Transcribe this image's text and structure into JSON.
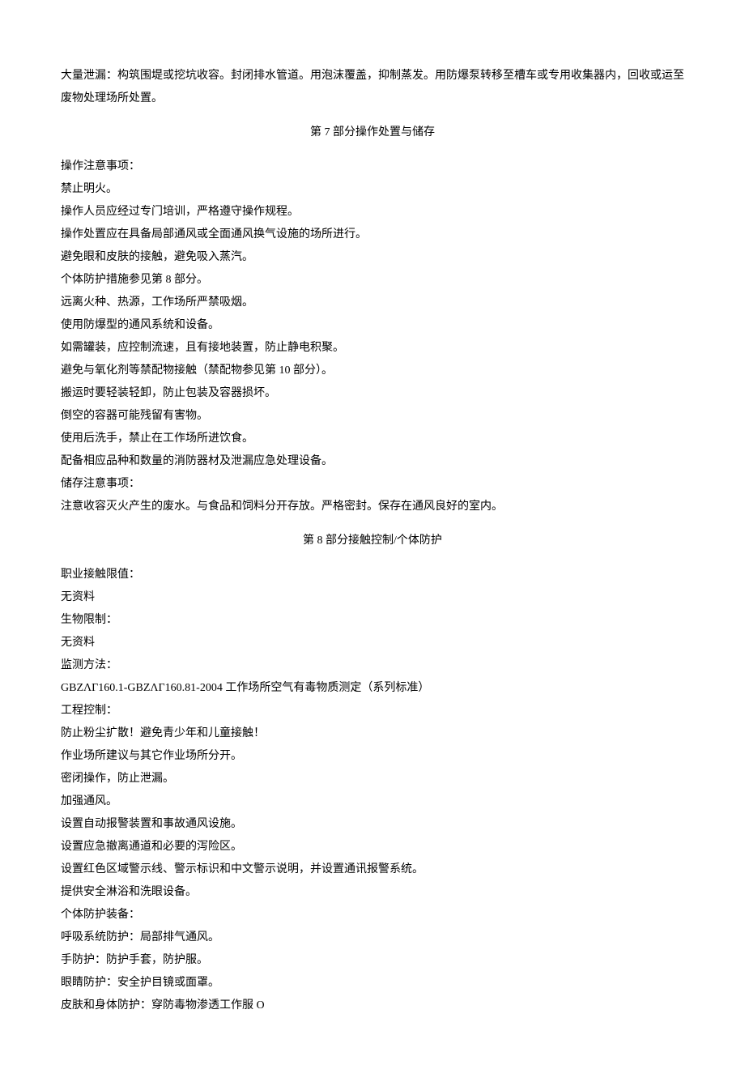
{
  "intro": "大量泄漏：构筑围堤或挖坑收容。封闭排水管道。用泡沫覆盖，抑制蒸发。用防爆泵转移至槽车或专用收集器内，回收或运至废物处理场所处置。",
  "section7": {
    "title": "第 7 部分操作处置与储存",
    "lines": [
      "操作注意事项：",
      "禁止明火。",
      "操作人员应经过专门培训，严格遵守操作规程。",
      "操作处置应在具备局部通风或全面通风换气设施的场所进行。",
      "避免眼和皮肤的接触，避免吸入蒸汽。",
      "个体防护措施参见第 8 部分。",
      "远离火种、热源，工作场所严禁吸烟。",
      "使用防爆型的通风系统和设备。",
      "如需罐装，应控制流速，且有接地装置，防止静电积聚。",
      "避免与氧化剂等禁配物接触（禁配物参见第 10 部分）。",
      "搬运时要轻装轻卸，防止包装及容器损坏。",
      "倒空的容器可能残留有害物。",
      "使用后洗手，禁止在工作场所进饮食。",
      "配备相应品种和数量的消防器材及泄漏应急处理设备。",
      "储存注意事项：",
      "注意收容灭火产生的废水。与食品和饲料分开存放。严格密封。保存在通风良好的室内。"
    ]
  },
  "section8": {
    "title": "第 8 部分接触控制/个体防护",
    "lines": [
      "职业接触限值：",
      "无资料",
      "生物限制：",
      "无资料",
      "监测方法：",
      "GBZΛΓ160.1-GBZΛΓ160.81-2004 工作场所空气有毒物质测定（系列标准）",
      "工程控制：",
      "防止粉尘扩散！避免青少年和儿童接触！",
      "作业场所建议与其它作业场所分开。",
      "密闭操作，防止泄漏。",
      "加强通风。",
      "设置自动报警装置和事故通风设施。",
      "设置应急撤离通道和必要的泻险区。",
      "设置红色区域警示线、警示标识和中文警示说明，并设置通讯报警系统。",
      "提供安全淋浴和洗眼设备。",
      "个体防护装备：",
      "呼吸系统防护：局部排气通风。",
      "手防护：防护手套，防护服。",
      "眼睛防护：安全护目镜或面罩。",
      "皮肤和身体防护：穿防毒物渗透工作服 O"
    ]
  }
}
